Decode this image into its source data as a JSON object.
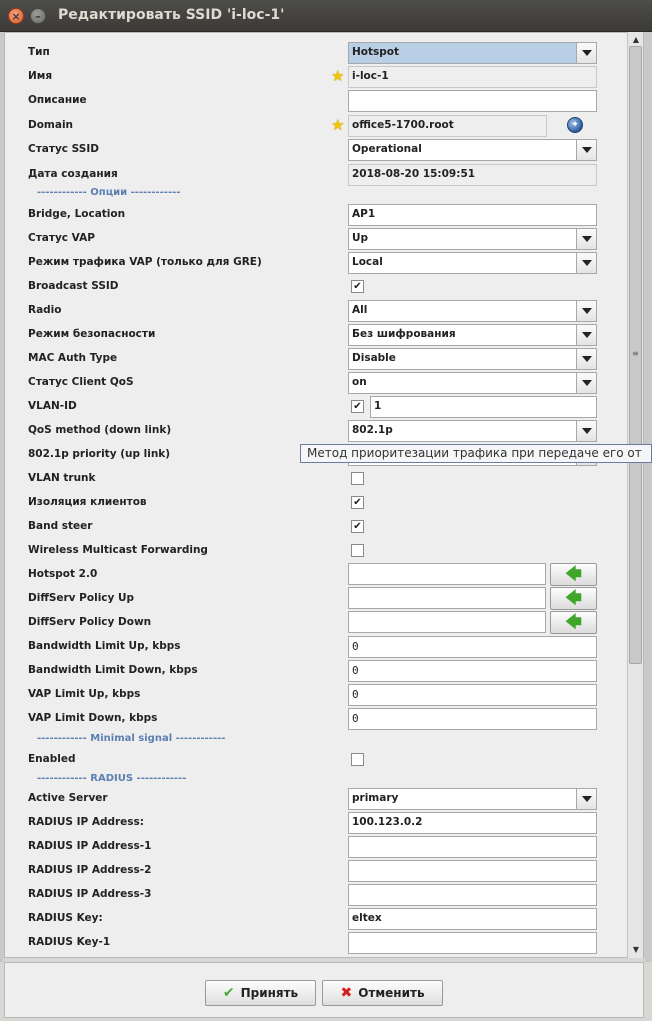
{
  "window": {
    "title": "Редактировать SSID 'i-loc-1'"
  },
  "icons": {
    "close": "close-icon",
    "minimize": "minimize-icon",
    "star": "star-icon",
    "globe": "globe-icon",
    "arrow": "arrow-left-icon"
  },
  "colors": {
    "section": "#5b7fb0",
    "arrow": "#3fa52b",
    "ok": "#4aa83a",
    "cancel": "#d42020"
  },
  "form": {
    "type": {
      "label": "Тип",
      "value": "Hotspot"
    },
    "name": {
      "label": "Имя",
      "value": "i-loc-1"
    },
    "description": {
      "label": "Описание",
      "value": ""
    },
    "domain": {
      "label": "Domain",
      "value": "office5-1700.root"
    },
    "ssid_status": {
      "label": "Статус SSID",
      "value": "Operational"
    },
    "created": {
      "label": "Дата создания",
      "value": "2018-08-20 15:09:51"
    },
    "section_options": "------------ Опции ------------",
    "bridge": {
      "label": "Bridge, Location",
      "value": "AP1"
    },
    "vap_status": {
      "label": "Статус VAP",
      "value": "Up"
    },
    "vap_traffic": {
      "label": "Режим трафика VAP (только для GRE)",
      "value": "Local"
    },
    "broadcast": {
      "label": "Broadcast SSID",
      "checked": true
    },
    "radio": {
      "label": "Radio",
      "value": "All"
    },
    "security": {
      "label": "Режим безопасности",
      "value": "Без шифрования"
    },
    "mac_auth": {
      "label": "MAC Auth Type",
      "value": "Disable"
    },
    "client_qos": {
      "label": "Статус Client QoS",
      "value": "on"
    },
    "vlan": {
      "label": "VLAN-ID",
      "checked": true,
      "value": "1"
    },
    "qos_method": {
      "label": "QoS method (down link)",
      "value": "802.1p"
    },
    "priority": {
      "label": "802.1p priority (up link)",
      "value": ""
    },
    "vlan_trunk": {
      "label": "VLAN trunk",
      "checked": false
    },
    "isolation": {
      "label": "Изоляция клиентов",
      "checked": true
    },
    "band_steer": {
      "label": "Band steer",
      "checked": true
    },
    "multicast": {
      "label": "Wireless Multicast Forwarding",
      "checked": false
    },
    "hotspot20": {
      "label": "Hotspot 2.0",
      "value": ""
    },
    "diffserv_up": {
      "label": "DiffServ Policy Up",
      "value": ""
    },
    "diffserv_down": {
      "label": "DiffServ Policy Down",
      "value": ""
    },
    "bw_up": {
      "label": "Bandwidth Limit Up, kbps",
      "value": "0"
    },
    "bw_down": {
      "label": "Bandwidth Limit Down, kbps",
      "value": "0"
    },
    "vap_up": {
      "label": "VAP Limit Up, kbps",
      "value": "0"
    },
    "vap_down": {
      "label": "VAP Limit Down, kbps",
      "value": "0"
    },
    "section_minimal": "------------ Minimal signal ------------",
    "enabled": {
      "label": "Enabled",
      "checked": false
    },
    "section_radius": "------------ RADIUS ------------",
    "active_server": {
      "label": "Active Server",
      "value": "primary"
    },
    "radius_ip": {
      "label": "RADIUS IP Address:",
      "value": "100.123.0.2"
    },
    "radius_ip1": {
      "label": "RADIUS IP Address-1",
      "value": ""
    },
    "radius_ip2": {
      "label": "RADIUS IP Address-2",
      "value": ""
    },
    "radius_ip3": {
      "label": "RADIUS IP Address-3",
      "value": ""
    },
    "radius_key": {
      "label": "RADIUS Key:",
      "value": "eltex"
    },
    "radius_key1": {
      "label": "RADIUS Key-1",
      "value": ""
    }
  },
  "tooltip": "Метод приоритезации трафика при передаче его от",
  "footer": {
    "ok_label": "Принять",
    "cancel_label": "Отменить"
  }
}
